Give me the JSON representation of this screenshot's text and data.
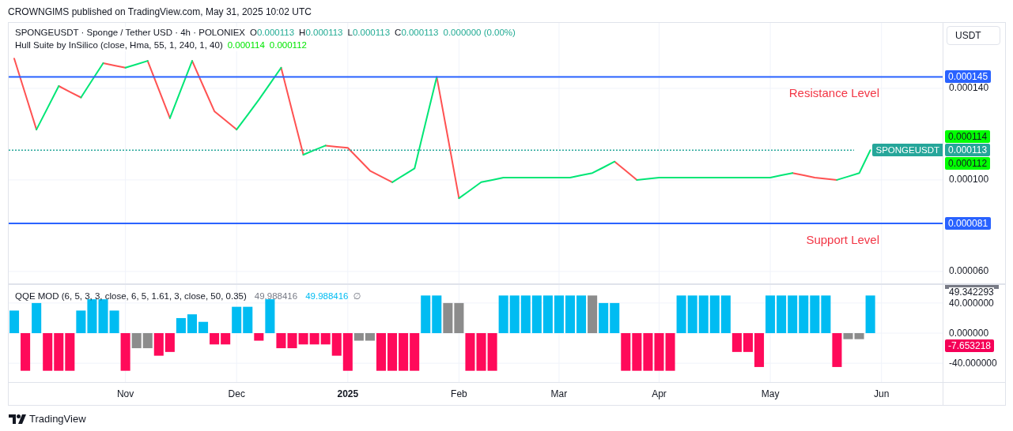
{
  "credit": "CROWNGIMS published on TradingView.com, May 31, 2025 10:02 UTC",
  "currency_button": "USDT",
  "main_pane": {
    "legend": {
      "symbol": "SPONGEUSDT · Sponge / Tether USD · 4h · POLONIEX",
      "ohlc": [
        {
          "label": "O",
          "value": "0.000113"
        },
        {
          "label": "H",
          "value": "0.000113"
        },
        {
          "label": "L",
          "value": "0.000113"
        },
        {
          "label": "C",
          "value": "0.000113"
        }
      ],
      "change": "0.000000 (0.00%)"
    },
    "indicator_legend": {
      "name": "Hull Suite by InSilico (close, Hma, 55, 1, 240, 1, 40)",
      "values": [
        "0.000114",
        "0.000112"
      ]
    },
    "chart_data": {
      "type": "line",
      "grid": true,
      "ylim": [
        5.48e-05,
        0.0001686
      ],
      "categories": [
        null,
        null,
        null,
        null,
        null,
        null,
        null,
        null,
        null,
        null,
        null,
        null,
        null,
        null,
        null,
        null,
        null,
        null,
        null,
        null,
        null,
        null,
        null,
        null,
        null,
        null,
        null,
        null,
        null,
        null,
        null,
        null,
        null,
        null,
        null,
        null,
        null,
        null,
        null,
        null,
        null,
        null,
        null,
        null,
        null,
        null,
        null,
        null,
        null,
        null,
        null,
        null,
        null,
        null,
        null,
        null,
        null,
        null,
        null,
        null,
        null,
        null,
        null,
        null,
        null,
        null,
        null,
        null,
        null,
        null,
        null,
        null,
        null,
        null,
        null,
        null,
        null,
        null,
        null,
        null,
        null,
        null,
        null,
        null
      ],
      "series": [
        {
          "color": "#ff5252",
          "values": [
            0.000153,
            0.0001375,
            0.000122,
            null,
            0.000141,
            0.0001385,
            0.000136,
            null,
            0.000151,
            0.00015,
            0.000149,
            null,
            0.000152,
            0.0001395,
            0.000127,
            null,
            0.000152,
            0.000141,
            0.00013,
            0.000126,
            0.000122,
            null,
            null,
            null,
            0.000149,
            0.00013,
            0.000111,
            null,
            0.000115,
            0.0001145,
            0.000114,
            0.000109,
            0.000104,
            0.0001015,
            9.9e-05,
            null,
            null,
            null,
            0.000145,
            0.0001185,
            9.2e-05,
            null,
            null,
            null,
            null,
            null,
            null,
            null,
            null,
            null,
            null,
            null,
            null,
            null,
            0.000108,
            0.000104,
            0.0001,
            null,
            null,
            null,
            null,
            null,
            null,
            null,
            null,
            null,
            null,
            null,
            null,
            null,
            0.000103,
            0.000102,
            0.000101,
            0.0001005,
            0.0001,
            null,
            null,
            null,
            null,
            null,
            null,
            null,
            null,
            null
          ]
        },
        {
          "color": "#00e676",
          "values": [
            null,
            null,
            0.000122,
            0.0001315,
            0.000141,
            null,
            0.000136,
            0.0001435,
            0.000151,
            null,
            0.000149,
            0.0001505,
            0.000152,
            null,
            0.000127,
            0.0001395,
            0.000152,
            null,
            null,
            null,
            0.000122,
            0.0001285,
            0.000135,
            0.000142,
            0.000149,
            null,
            0.000111,
            0.000113,
            0.000115,
            null,
            null,
            null,
            null,
            null,
            9.9e-05,
            0.000102,
            0.000105,
            0.000125,
            0.000145,
            null,
            9.2e-05,
            9.55e-05,
            9.9e-05,
            0.0001,
            0.000101,
            0.000101,
            0.000101,
            0.000101,
            0.000101,
            0.000101,
            0.000101,
            0.000102,
            0.000103,
            0.0001055,
            0.000108,
            null,
            0.0001,
            0.0001005,
            0.000101,
            0.000101,
            0.000101,
            0.000101,
            0.000101,
            0.000101,
            0.000101,
            0.000101,
            0.000101,
            0.000101,
            0.000101,
            0.000102,
            0.000103,
            null,
            null,
            null,
            0.0001,
            0.0001015,
            0.000103,
            0.000113,
            null,
            null,
            null,
            null,
            null,
            null
          ]
        }
      ],
      "yticks": [
        {
          "value": 0.00014,
          "label": "0.000140"
        },
        {
          "value": 0.0001,
          "label": "0.000100"
        },
        {
          "value": 6e-05,
          "label": "0.000060"
        }
      ]
    },
    "price_tags": [
      {
        "kind": "level",
        "text": "0.000145",
        "color": "#2962ff",
        "label": "Resistance Level"
      },
      {
        "kind": "indicator",
        "text": "0.000114",
        "color": "#00ff00"
      },
      {
        "kind": "last",
        "text": "0.000113",
        "color": "#26a69a",
        "symbol": "SPONGEUSDT"
      },
      {
        "kind": "indicator",
        "text": "0.000112",
        "color": "#00ff00"
      },
      {
        "kind": "level",
        "text": "0.000081",
        "color": "#2962ff",
        "label": "Support Level"
      }
    ]
  },
  "qqe_pane": {
    "legend": {
      "name": "QQE MOD (6, 5, 3, 3, close, 6, 5, 1.61, 3, close, 50, 0.35)",
      "values": [
        {
          "text": "49.988416",
          "color": "#787b86"
        },
        {
          "text": "49.988416",
          "color": "#00bcf2"
        }
      ],
      "icon_glyph": "∅"
    },
    "chart_data": {
      "type": "bar",
      "grid": true,
      "ylim": [
        -65,
        64
      ],
      "categories": [
        null,
        null,
        null,
        null,
        null,
        null,
        null,
        null,
        null,
        null,
        "Nov",
        null,
        null,
        null,
        null,
        null,
        null,
        null,
        null,
        null,
        "Dec",
        null,
        null,
        null,
        null,
        null,
        null,
        null,
        null,
        null,
        "2025",
        null,
        null,
        null,
        null,
        null,
        null,
        null,
        null,
        null,
        "Feb",
        null,
        null,
        null,
        null,
        null,
        null,
        null,
        null,
        "Mar",
        null,
        null,
        null,
        null,
        null,
        null,
        null,
        null,
        "Apr",
        null,
        null,
        null,
        null,
        null,
        null,
        null,
        null,
        null,
        "May",
        null,
        null,
        null,
        null,
        null,
        null,
        null,
        null,
        null,
        "Jun",
        null,
        null,
        null,
        null,
        null
      ],
      "series": [
        {
          "color": "#00bcf2",
          "values": [
            30,
            null,
            40,
            null,
            null,
            null,
            30,
            45,
            45,
            30,
            null,
            null,
            null,
            null,
            null,
            20,
            25,
            15,
            null,
            null,
            35,
            35,
            null,
            45,
            null,
            null,
            null,
            null,
            null,
            null,
            null,
            null,
            null,
            null,
            null,
            null,
            null,
            50,
            50,
            null,
            null,
            null,
            null,
            null,
            50,
            50,
            50,
            50,
            50,
            50,
            50,
            50,
            null,
            40,
            40,
            null,
            null,
            null,
            null,
            null,
            50,
            50,
            50,
            50,
            50,
            null,
            null,
            null,
            50,
            50,
            50,
            50,
            50,
            50,
            null,
            null,
            null,
            50,
            null,
            null,
            null,
            null,
            null,
            null
          ]
        },
        {
          "color": "#ff0a5a",
          "values": [
            null,
            -50,
            null,
            -50,
            -50,
            -50,
            null,
            null,
            null,
            null,
            -50,
            null,
            null,
            -30,
            -25,
            null,
            null,
            null,
            -15,
            -15,
            null,
            null,
            -10,
            null,
            -20,
            -20,
            -15,
            -15,
            -15,
            -30,
            -50,
            null,
            null,
            -50,
            -50,
            -50,
            -50,
            null,
            null,
            null,
            null,
            -50,
            -50,
            -50,
            null,
            null,
            null,
            null,
            null,
            null,
            null,
            null,
            null,
            null,
            null,
            -50,
            -50,
            -50,
            -50,
            -50,
            null,
            null,
            null,
            null,
            null,
            -25,
            -25,
            -45,
            null,
            null,
            null,
            null,
            null,
            null,
            -45,
            null,
            null,
            null,
            null,
            null,
            null,
            null,
            null,
            null
          ]
        },
        {
          "color": "#8c8c8c",
          "values": [
            null,
            null,
            null,
            null,
            null,
            null,
            null,
            null,
            null,
            null,
            null,
            -20,
            -20,
            null,
            null,
            null,
            null,
            null,
            null,
            null,
            null,
            null,
            null,
            null,
            null,
            null,
            null,
            null,
            null,
            null,
            null,
            -10,
            -10,
            null,
            null,
            null,
            null,
            null,
            null,
            40,
            40,
            null,
            null,
            null,
            null,
            null,
            null,
            null,
            null,
            null,
            null,
            null,
            50,
            null,
            null,
            null,
            null,
            null,
            null,
            null,
            null,
            null,
            null,
            null,
            null,
            null,
            null,
            null,
            null,
            null,
            null,
            null,
            null,
            null,
            null,
            -8,
            -8,
            null,
            null,
            null,
            null,
            null,
            null,
            null
          ]
        }
      ],
      "yticks": [
        {
          "value": 40,
          "label": "40.000000"
        },
        {
          "value": 0,
          "label": "0.000000"
        },
        {
          "value": -40,
          "label": "-40.000000"
        }
      ]
    },
    "value_tags": [
      {
        "kind": "plain",
        "text": "49.342293"
      },
      {
        "kind": "tag",
        "text": "-7.653218",
        "color": "#f50057"
      }
    ]
  },
  "footer": {
    "brand": "TradingView"
  }
}
